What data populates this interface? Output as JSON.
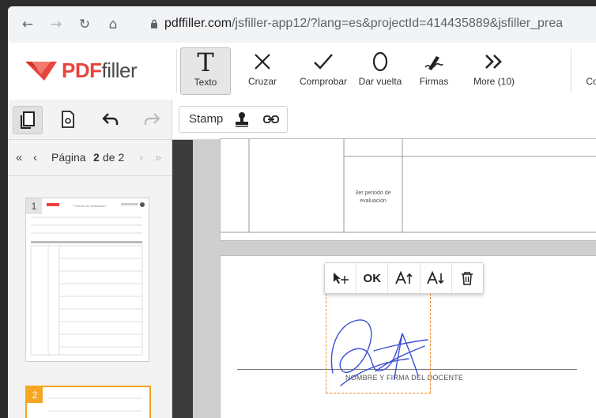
{
  "browser": {
    "url_host": "pdffiller.com",
    "url_path": "/jsfiller-app12/?lang=es&projectId=414435889&jsfiller_prea"
  },
  "app": {
    "logo_pdf": "PDF",
    "logo_filler": "filler"
  },
  "toolbar": {
    "tools": [
      {
        "label": "Texto",
        "icon": "text-T-icon"
      },
      {
        "label": "Cruzar",
        "icon": "cross-icon"
      },
      {
        "label": "Comprobar",
        "icon": "check-icon"
      },
      {
        "label": "Dar vuelta",
        "icon": "circle-icon"
      },
      {
        "label": "Firmas",
        "icon": "signature-pen-icon"
      },
      {
        "label": "More (10)",
        "icon": "double-chevron-icon"
      }
    ],
    "cut_label": "Co"
  },
  "sidebar": {
    "pager_prefix": "Página",
    "pager_current": "2",
    "pager_of": "de 2",
    "thumbs": [
      {
        "num": "1",
        "header": "Formato de evaluación"
      },
      {
        "num": "2"
      }
    ]
  },
  "subbar": {
    "stamp_label": "Stamp"
  },
  "document": {
    "period_label": "3er periodo de evaluación",
    "signature_caption": "NOMBRE Y FIRMA DEL DOCENTE"
  },
  "floating_toolbar": {
    "ok_label": "OK"
  },
  "colors": {
    "brand_red": "#e8453c",
    "active_orange": "#f5a623",
    "signature_blue": "#3a4fd6"
  }
}
